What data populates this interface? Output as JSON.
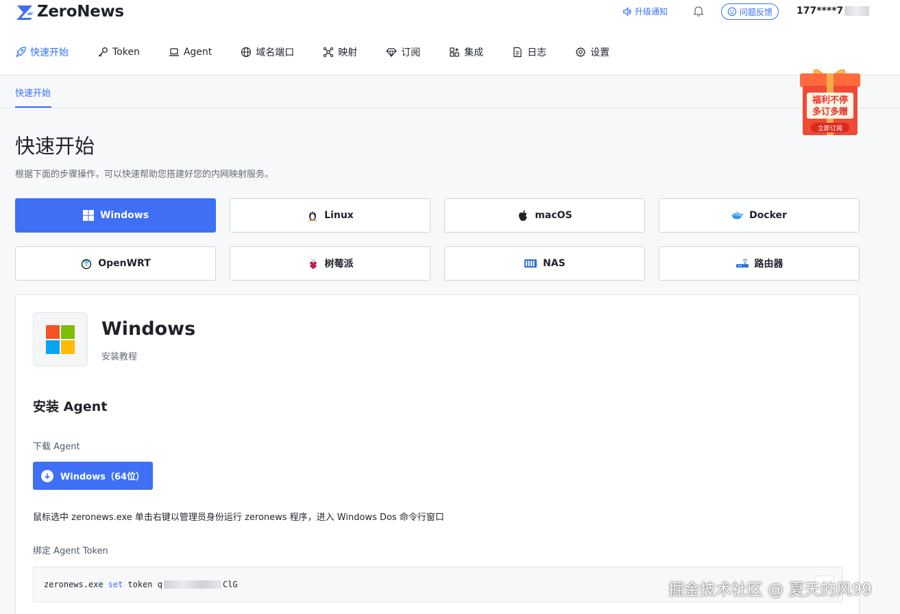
{
  "header": {
    "logo_text": "ZeroNews",
    "upgrade_label": "升级通知",
    "feedback_label": "问题反馈",
    "user_phone": "177****7"
  },
  "nav": {
    "items": [
      {
        "label": "快速开始",
        "icon": "rocket-icon",
        "active": true
      },
      {
        "label": "Token",
        "icon": "key-icon"
      },
      {
        "label": "Agent",
        "icon": "laptop-icon"
      },
      {
        "label": "域名端口",
        "icon": "globe-icon"
      },
      {
        "label": "映射",
        "icon": "network-icon"
      },
      {
        "label": "订阅",
        "icon": "diamond-icon"
      },
      {
        "label": "集成",
        "icon": "apps-icon"
      },
      {
        "label": "日志",
        "icon": "document-icon"
      },
      {
        "label": "设置",
        "icon": "gear-icon"
      }
    ]
  },
  "subnav": {
    "active_tab": "快速开始"
  },
  "promo": {
    "line1": "福利不停",
    "line2": "多订多赠",
    "cta": "立即订阅"
  },
  "page": {
    "title": "快速开始",
    "description": "根据下面的步骤操作，可以快速帮助您搭建好您的内网映射服务。"
  },
  "os_options": [
    {
      "label": "Windows",
      "icon": "windows-icon",
      "active": true
    },
    {
      "label": "Linux",
      "icon": "linux-icon"
    },
    {
      "label": "macOS",
      "icon": "apple-icon"
    },
    {
      "label": "Docker",
      "icon": "docker-icon"
    },
    {
      "label": "OpenWRT",
      "icon": "openwrt-icon"
    },
    {
      "label": "树莓派",
      "icon": "raspberry-pi-icon"
    },
    {
      "label": "NAS",
      "icon": "nas-icon"
    },
    {
      "label": "路由器",
      "icon": "router-icon"
    }
  ],
  "card": {
    "title": "Windows",
    "subtitle": "安装教程",
    "section_title": "安装 Agent",
    "download_label": "下载 Agent",
    "download_button": "Windows（64位）",
    "hint": "鼠标选中 zeronews.exe 单击右键以管理员身份运行 zeronews 程序，进入 Windows Dos 命令行窗口",
    "bind_label": "绑定 Agent Token",
    "code_cmd": "zeronews.exe",
    "code_kw": "set",
    "code_arg": "token q",
    "code_tail": "ClG"
  },
  "watermark": "掘金技术社区 @ 夏天的风99",
  "colors": {
    "accent": "#3e6ff4",
    "link": "#3370ff",
    "promo_red": "#f04a36",
    "promo_gold": "#f7b84b"
  }
}
